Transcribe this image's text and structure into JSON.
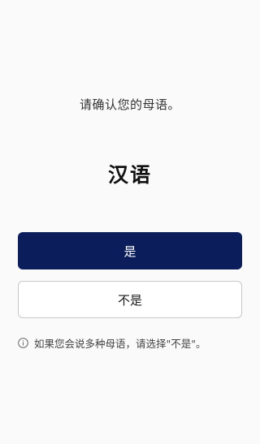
{
  "prompt": "请确认您的母语。",
  "language": "汉语",
  "buttons": {
    "yes_label": "是",
    "no_label": "不是"
  },
  "note": {
    "icon": "info-icon",
    "text": "如果您会说多种母语，请选择\"不是\"。"
  },
  "colors": {
    "primary": "#0b1e5b",
    "background": "#fafafa"
  }
}
